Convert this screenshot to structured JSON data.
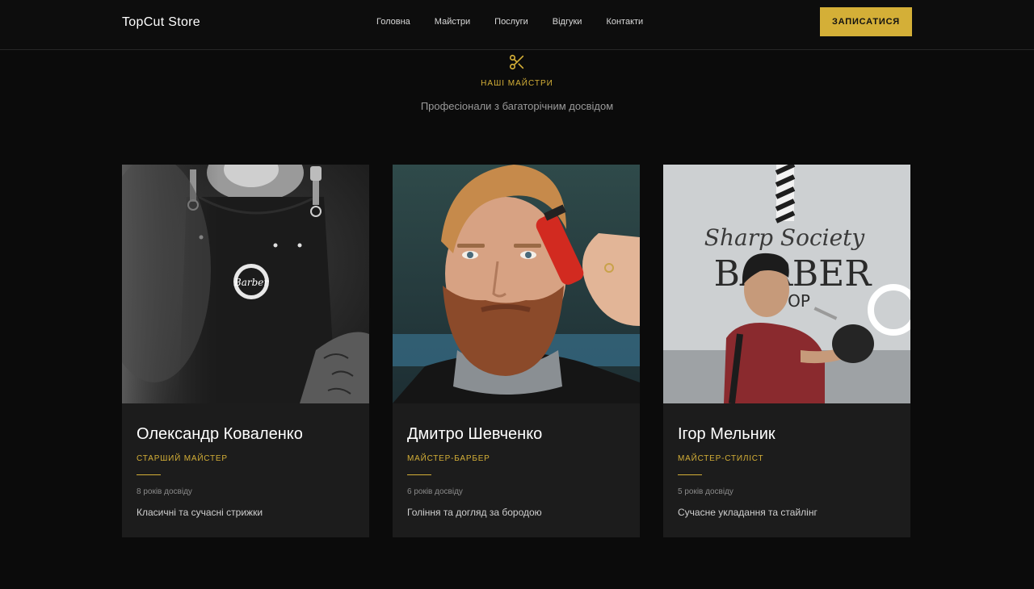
{
  "header": {
    "brand": "TopCut Store",
    "nav": [
      "Головна",
      "Майстри",
      "Послуги",
      "Відгуки",
      "Контакти"
    ],
    "cta_label": "ЗАПИСАТИСЯ"
  },
  "section": {
    "eyebrow": "НАШІ МАЙСТРИ",
    "subtitle": "Професіонали з багаторічним досвідом",
    "icon": "scissors-icon"
  },
  "barbers": [
    {
      "name": "Олександр Коваленко",
      "role": "СТАРШИЙ МАЙСТЕР",
      "experience": "8 років досвіду",
      "specialty": "Класичні та сучасні стрижки"
    },
    {
      "name": "Дмитро Шевченко",
      "role": "МАЙСТЕР-БАРБЕР",
      "experience": "6 років досвіду",
      "specialty": "Гоління та догляд за бородою"
    },
    {
      "name": "Ігор Мельник",
      "role": "МАЙСТЕР-СТИЛІСТ",
      "experience": "5 років досвіду",
      "specialty": "Сучасне укладання та стайлінг"
    }
  ],
  "photo3_sign": {
    "line1": "Sharp Society",
    "line2": "BARBER",
    "line3": "OP"
  },
  "photo1_logo_text": "Barber",
  "colors": {
    "accent": "#d4af37",
    "background": "#0b0b0b",
    "card": "#1c1c1c"
  }
}
